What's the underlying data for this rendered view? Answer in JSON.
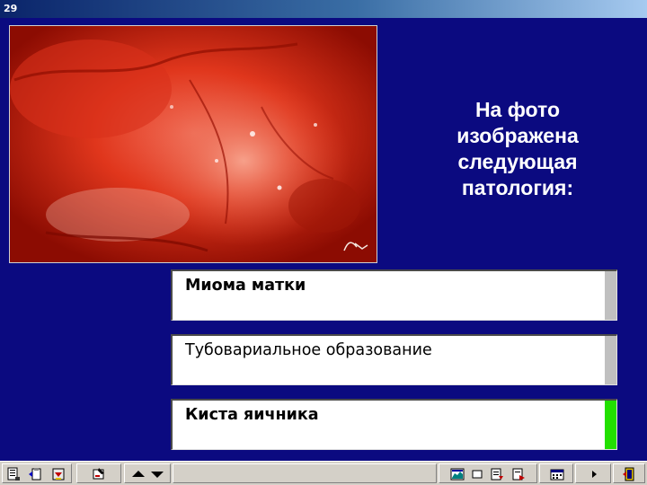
{
  "window": {
    "title": "29"
  },
  "slide": {
    "question": "На фото изображена следующая патология:",
    "answers": [
      {
        "label": "Миома матки",
        "bold": true,
        "indicator": "neutral"
      },
      {
        "label": "Тубовариальное образование",
        "bold": false,
        "indicator": "neutral"
      },
      {
        "label": "Киста яичника",
        "bold": true,
        "indicator": "correct"
      }
    ],
    "colors": {
      "background": "#0b0a80",
      "correct_indicator": "#22e000",
      "neutral_indicator": "#c0c0c0"
    }
  },
  "toolbar": {
    "icons": [
      "notes-icon",
      "clipboard-icon",
      "save-icon",
      "tools-icon",
      "arrow-up-icon",
      "arrow-down-icon",
      "chart-icon",
      "window-icon",
      "edit-icon",
      "export-icon",
      "calendar-icon",
      "play-icon",
      "exit-door-icon"
    ]
  }
}
